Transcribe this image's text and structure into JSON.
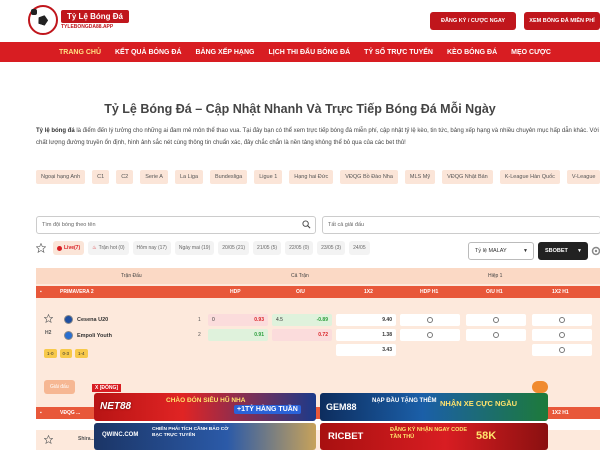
{
  "header": {
    "logo_text": "Tỷ Lệ Bóng Đá",
    "logo_sub": "TYLEBONGDA88.APP",
    "btn_register": "ĐĂNG KÝ / CƯỢC NGAY",
    "btn_watch": "XEM BÓNG ĐÁ MIỄN PHÍ"
  },
  "nav": [
    "TRANG CHỦ",
    "KẾT QUẢ BÓNG ĐÁ",
    "BẢNG XẾP HẠNG",
    "LỊCH THI ĐẤU BÓNG ĐÁ",
    "TỶ SỐ TRỰC TUYẾN",
    "KÈO BÓNG ĐÁ",
    "MẸO CƯỢC"
  ],
  "page": {
    "title": "Tỷ Lệ Bóng Đá – Cập Nhật Nhanh Và Trực Tiếp Bóng Đá Mỗi Ngày",
    "intro_bold": "Tỷ lệ bóng đá",
    "intro_rest": " là điểm đến lý tưởng cho những ai đam mê môn thể thao vua. Tại đây bạn có thể xem trực tiếp bóng đá miễn phí, cập nhật tỷ lệ kèo, tin tức, bảng xếp hạng và nhiều chuyên mục hấp dẫn khác. Với chất lượng đường truyền ổn định, hình ảnh sắc nét cùng thông tin chuẩn xác, đây chắc chắn là nền tảng không thể bỏ qua của các bet thủ!"
  },
  "tags": [
    "Ngoại hạng Anh",
    "C1",
    "C2",
    "Serie A",
    "La Liga",
    "Bundesliga",
    "Ligue 1",
    "Hạng hai Đức",
    "VĐQG Bồ Đào Nha",
    "MLS Mỹ",
    "VĐQG Nhật Bản",
    "K-League Hàn Quốc",
    "V-League"
  ],
  "search": {
    "team_placeholder": "Tìm đội bóng theo tên",
    "league_placeholder": "Tất cả giải đấu"
  },
  "dates": [
    "Live(7)",
    "Trận hot (0)",
    "Hôm nay (17)",
    "Ngày mai (19)",
    "20/05 (21)",
    "21/05 (5)",
    "22/05 (0)",
    "23/05 (3)",
    "24/05"
  ],
  "filters": {
    "odds_type": "Tỷ lệ MALAY",
    "bookmaker": "SBOBET"
  },
  "table": {
    "head": {
      "match": "Trận Đấu",
      "full": "Cả Trận",
      "half": "Hiệp 1"
    },
    "league": "PRIMAVERA 2",
    "cols": [
      "HDP",
      "O/U",
      "1X2",
      "HDP H1",
      "O/U H1",
      "1X2 H1"
    ],
    "home": "Cesena U20",
    "away": "Empoli Youth",
    "minute": "H2",
    "row_index": [
      "1",
      "2"
    ],
    "hdp_home": {
      "line": "0",
      "val": "0.93"
    },
    "ou_home": {
      "line": "4.5",
      "val": "-0.89"
    },
    "hdp_away": {
      "line": "",
      "val": "0.91"
    },
    "ou_away": {
      "line": "",
      "val": "0.72"
    },
    "x12": [
      "9.40",
      "1.38",
      "3.43"
    ],
    "chips": [
      "1-0",
      "0-3",
      "1-4"
    ],
    "ghost": "Giải đấu",
    "league2": "VĐQG ...",
    "team3": "Shira..."
  },
  "ads": {
    "close": "X [ĐÓNG]",
    "a1": "NET88",
    "a2": "CHÀO ĐÓN SIÊU HŨ NHA",
    "a3": "+1TỶ HÀNG TUẦN",
    "a4": "GEM88",
    "a5": "NẠP ĐẦU TẶNG THÊM",
    "a6": "NHẬN XE CỰC NGẦU",
    "a7": "QWINC.COM",
    "a8": "CHIẾN PHÁI TÍCH CẦNH BẢO CỜ BẠC TRỰC TUYẾN",
    "a9": "RICBET",
    "a10": "ĐĂNG KÝ NHẬN NGAY CODE TẦN THỦ",
    "a10_amount": "58K"
  },
  "colors": {
    "brand_red": "#d81d22",
    "nav_active": "#ffe083",
    "table_bg": "#fde9dc"
  }
}
